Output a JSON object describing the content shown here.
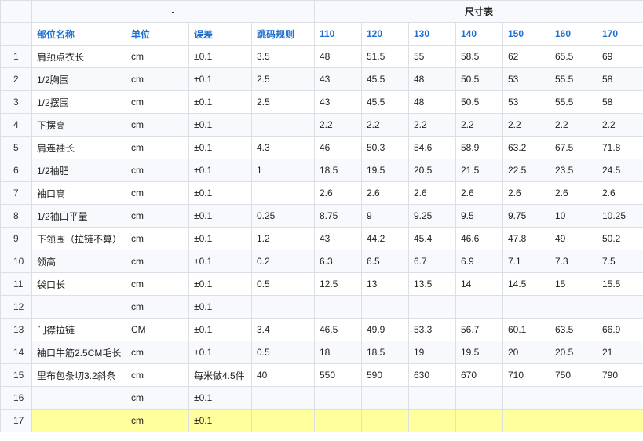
{
  "header": {
    "group_left": "-",
    "group_right": "尺寸表"
  },
  "columns": [
    "部位名称",
    "单位",
    "误差",
    "跳码规则",
    "110",
    "120",
    "130",
    "140",
    "150",
    "160",
    "170"
  ],
  "rows": [
    {
      "n": "1",
      "cells": [
        "肩颈点衣长",
        "cm",
        "±0.1",
        "3.5",
        "48",
        "51.5",
        "55",
        "58.5",
        "62",
        "65.5",
        "69"
      ]
    },
    {
      "n": "2",
      "cells": [
        "1/2胸围",
        "cm",
        "±0.1",
        "2.5",
        "43",
        "45.5",
        "48",
        "50.5",
        "53",
        "55.5",
        "58"
      ]
    },
    {
      "n": "3",
      "cells": [
        "1/2摆围",
        "cm",
        "±0.1",
        "2.5",
        "43",
        "45.5",
        "48",
        "50.5",
        "53",
        "55.5",
        "58"
      ]
    },
    {
      "n": "4",
      "cells": [
        "下摆高",
        "cm",
        "±0.1",
        "",
        "2.2",
        "2.2",
        "2.2",
        "2.2",
        "2.2",
        "2.2",
        "2.2"
      ]
    },
    {
      "n": "5",
      "cells": [
        "肩连袖长",
        "cm",
        "±0.1",
        "4.3",
        "46",
        "50.3",
        "54.6",
        "58.9",
        "63.2",
        "67.5",
        "71.8"
      ]
    },
    {
      "n": "6",
      "cells": [
        "1/2袖肥",
        "cm",
        "±0.1",
        "1",
        "18.5",
        "19.5",
        "20.5",
        "21.5",
        "22.5",
        "23.5",
        "24.5"
      ]
    },
    {
      "n": "7",
      "cells": [
        "袖口高",
        "cm",
        "±0.1",
        "",
        "2.6",
        "2.6",
        "2.6",
        "2.6",
        "2.6",
        "2.6",
        "2.6"
      ]
    },
    {
      "n": "8",
      "cells": [
        "1/2袖口平量",
        "cm",
        "±0.1",
        "0.25",
        "8.75",
        "9",
        "9.25",
        "9.5",
        "9.75",
        "10",
        "10.25"
      ]
    },
    {
      "n": "9",
      "cells": [
        "下领围（拉链不算）",
        "cm",
        "±0.1",
        "1.2",
        "43",
        "44.2",
        "45.4",
        "46.6",
        "47.8",
        "49",
        "50.2"
      ]
    },
    {
      "n": "10",
      "cells": [
        "领高",
        "cm",
        "±0.1",
        "0.2",
        "6.3",
        "6.5",
        "6.7",
        "6.9",
        "7.1",
        "7.3",
        "7.5"
      ]
    },
    {
      "n": "11",
      "cells": [
        "袋口长",
        "cm",
        "±0.1",
        "0.5",
        "12.5",
        "13",
        "13.5",
        "14",
        "14.5",
        "15",
        "15.5"
      ]
    },
    {
      "n": "12",
      "cells": [
        "",
        "cm",
        "±0.1",
        "",
        "",
        "",
        "",
        "",
        "",
        "",
        ""
      ]
    },
    {
      "n": "13",
      "cells": [
        "门襟拉链",
        "CM",
        "±0.1",
        "3.4",
        "46.5",
        "49.9",
        "53.3",
        "56.7",
        "60.1",
        "63.5",
        "66.9"
      ]
    },
    {
      "n": "14",
      "cells": [
        "袖口牛筋2.5CM毛长",
        "cm",
        "±0.1",
        "0.5",
        "18",
        "18.5",
        "19",
        "19.5",
        "20",
        "20.5",
        "21"
      ]
    },
    {
      "n": "15",
      "cells": [
        "里布包条切3.2斜条",
        "cm",
        "每米做4.5件",
        "40",
        "550",
        "590",
        "630",
        "670",
        "710",
        "750",
        "790"
      ]
    },
    {
      "n": "16",
      "cells": [
        "",
        "cm",
        "±0.1",
        "",
        "",
        "",
        "",
        "",
        "",
        "",
        ""
      ]
    },
    {
      "n": "17",
      "cells": [
        "",
        "cm",
        "±0.1",
        "",
        "",
        "",
        "",
        "",
        "",
        "",
        ""
      ],
      "highlight": true
    }
  ],
  "colors": {
    "header_text": "#1f6fd0",
    "highlight_row": "#ffff9e",
    "grid": "#dcdfe6"
  }
}
